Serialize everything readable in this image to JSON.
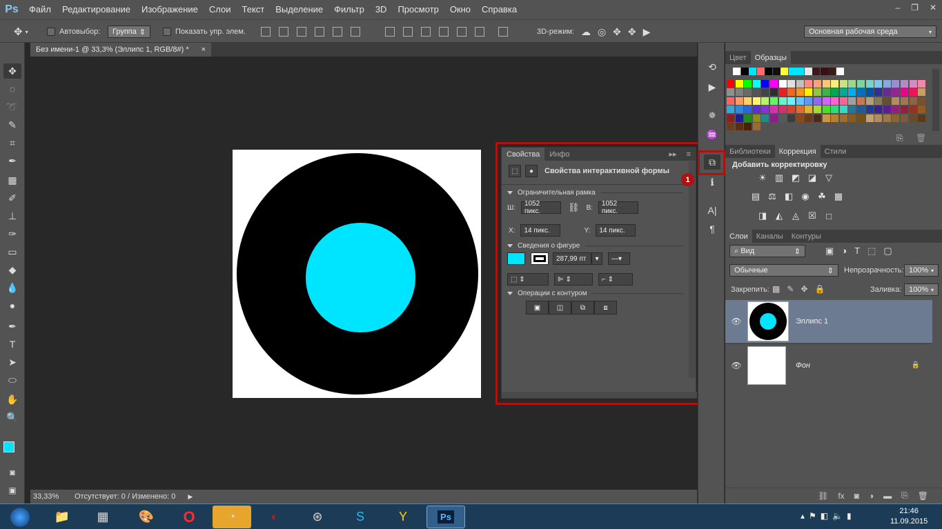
{
  "app": {
    "logo": "Ps"
  },
  "menu": [
    "Файл",
    "Редактирование",
    "Изображение",
    "Слои",
    "Текст",
    "Выделение",
    "Фильтр",
    "3D",
    "Просмотр",
    "Окно",
    "Справка"
  ],
  "window_controls": [
    "–",
    "❐",
    "✕"
  ],
  "options": {
    "autoselect_label": "Автовыбор:",
    "autoselect_value": "Группа",
    "show_controls_label": "Показать упр. элем.",
    "mode3d_label": "3D-режим:",
    "workspace": "Основная рабочая среда"
  },
  "document": {
    "tab_title": "Без имени-1 @ 33,3% (Эллипс 1, RGB/8#) *",
    "close": "×"
  },
  "status": {
    "zoom": "33,33%",
    "info": "Отсутствует: 0 / Изменено: 0"
  },
  "properties": {
    "tab_properties": "Свойства",
    "tab_info": "Инфо",
    "header": "Свойства интерактивной формы",
    "bbox_section": "Ограничительная рамка",
    "w_label": "Ш:",
    "w_value": "1052 пикс.",
    "h_label": "В:",
    "h_value": "1052 пикс.",
    "x_label": "X:",
    "x_value": "14 пикс.",
    "y_label": "Y:",
    "y_value": "14 пикс.",
    "shape_section": "Сведения о фигуре",
    "stroke_size": "287,99 пт",
    "path_section": "Операции с контуром",
    "fill_color": "#00e5ff",
    "stroke_color": "#000000"
  },
  "badge": "1",
  "swatch_panel": {
    "tab_color": "Цвет",
    "tab_swatches": "Образцы"
  },
  "swatches_row1": [
    "#ffffff",
    "#000000",
    "#00e5ff",
    "#ff6a6a",
    "#000000",
    "#101010",
    "#ffff33",
    "#00e5ff",
    "#00e5ff",
    "#e8e8e8",
    "#3a1a1a",
    "#3a1010",
    "#3a1a1a",
    "#ffffff"
  ],
  "swatches_grid": [
    [
      "#ff0000",
      "#ffff00",
      "#00ff00",
      "#00ffff",
      "#0000ff",
      "#ff00ff",
      "#ffffff",
      "#e0e0e0",
      "#c0c0c0",
      "#ff8b8b",
      "#f7a27a",
      "#f7c77a",
      "#f5ed7d",
      "#c5e57d",
      "#9bd88d",
      "#7fd3a3",
      "#7ad2c9",
      "#7dc7e8",
      "#87a8da",
      "#9b8ecf",
      "#b38ac9",
      "#d48ac3",
      "#f08aa6"
    ],
    [
      "#909090",
      "#808080",
      "#6a6a6a",
      "#555555",
      "#444444",
      "#2e2e2e",
      "#ee1c24",
      "#f36523",
      "#f7941d",
      "#fff200",
      "#8dc63f",
      "#39b54a",
      "#00a651",
      "#00a99d",
      "#00aeef",
      "#0072bc",
      "#0054a6",
      "#2e3192",
      "#662d91",
      "#92278f",
      "#ec008c",
      "#ed145b",
      "#c3a06b"
    ],
    [
      "#ff6464",
      "#ff9c64",
      "#ffd264",
      "#fff564",
      "#b4f564",
      "#64f564",
      "#64f5c8",
      "#64f5ff",
      "#64c8ff",
      "#6496ff",
      "#9664ff",
      "#d264ff",
      "#ff64d2",
      "#ff6496",
      "#a0a0a0",
      "#c87850",
      "#b4a078",
      "#8c7850",
      "#645030",
      "#b48c64",
      "#a07850",
      "#8c6440",
      "#785030"
    ],
    [
      "#2eaadc",
      "#2e8bdc",
      "#2e64dc",
      "#5a2edc",
      "#8b2edc",
      "#dc2eb4",
      "#dc2e64",
      "#dc412e",
      "#dc6e2e",
      "#dcb42e",
      "#a4dc2e",
      "#4adc2e",
      "#2edc7d",
      "#2edcc8",
      "#1e7896",
      "#1e5a96",
      "#1e3c96",
      "#3c1e96",
      "#5a1e96",
      "#961e78",
      "#961e3c",
      "#96321e",
      "#965a1e"
    ],
    [
      "#8c1e1e",
      "#1e1e8c",
      "#1e8c1e",
      "#8c8c1e",
      "#1e8c8c",
      "#8c1e8c",
      "#5a5a5a",
      "#3c3c3c",
      "#8a4a1a",
      "#6a3a1a",
      "#4a2a1a",
      "#c89646",
      "#b48232",
      "#a06e28",
      "#8c5a1e",
      "#785014",
      "#c8a06e",
      "#b48c5a",
      "#a07846",
      "#8c6432",
      "#7a5a3a",
      "#6a4a2a",
      "#5a3a1a"
    ],
    [
      "#6e3c1e",
      "#5a2d14",
      "#46200a",
      "#9a6a3a"
    ]
  ],
  "adjust_panel": {
    "tab_lib": "Библиотеки",
    "tab_adj": "Коррекция",
    "tab_styles": "Стили",
    "header": "Добавить корректировку"
  },
  "adjust_icons_row1": [
    "☀",
    "▥",
    "◩",
    "◪",
    "▽"
  ],
  "adjust_icons_row2": [
    "▤",
    "⚖",
    "◧",
    "◉",
    "☘",
    "▦"
  ],
  "adjust_icons_row3": [
    "◨",
    "◭",
    "◬",
    "☒",
    "□"
  ],
  "layers_panel": {
    "tab_layers": "Слои",
    "tab_channels": "Каналы",
    "tab_paths": "Контуры",
    "filter": "Вид",
    "blend": "Обычные",
    "opacity_label": "Непрозрачность:",
    "opacity_value": "100%",
    "lock_label": "Закрепить:",
    "fill_label": "Заливка:",
    "fill_value": "100%",
    "layers": [
      {
        "name": "Эллипс 1"
      },
      {
        "name": "Фон"
      }
    ]
  },
  "tray": {
    "time": "21:46",
    "date": "11.09.2015"
  }
}
